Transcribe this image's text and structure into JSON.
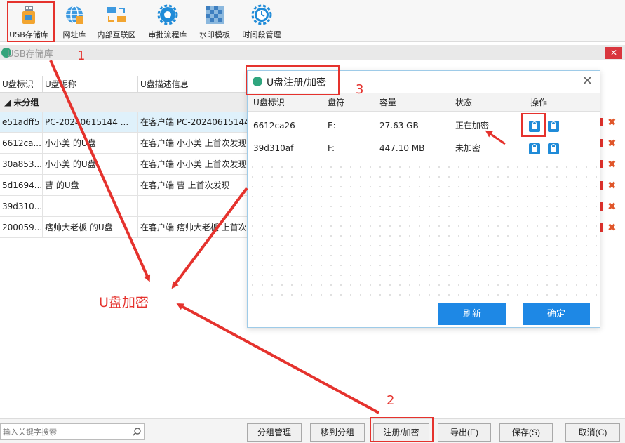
{
  "toolbar": {
    "items": [
      {
        "label": "USB存储库",
        "icon": "usb-storage-icon"
      },
      {
        "label": "网址库",
        "icon": "globe-icon"
      },
      {
        "label": "内部互联区",
        "icon": "network-icon"
      },
      {
        "label": "审批流程库",
        "icon": "approval-gear-icon"
      },
      {
        "label": "水印模板",
        "icon": "watermark-icon"
      },
      {
        "label": "时间段管理",
        "icon": "clock-gear-icon"
      }
    ]
  },
  "window": {
    "title": "USB存储库",
    "close": "✕"
  },
  "table": {
    "columns": [
      "U盘标识",
      "U盘昵称",
      "U盘描述信息"
    ],
    "group": "未分组",
    "rows": [
      {
        "id": "e51adff5",
        "nick": "PC-20240615144 ...",
        "desc": "在客户端 PC-20240615144"
      },
      {
        "id": "6612ca...",
        "nick": "小小美 的U盘",
        "desc": "在客户端 小小美 上首次发现"
      },
      {
        "id": "30a853...",
        "nick": "小小美 的U盘",
        "desc": "在客户端 小小美 上首次发现"
      },
      {
        "id": "5d1694...",
        "nick": "曹 的U盘",
        "desc": "在客户端 曹 上首次发现"
      },
      {
        "id": "39d310...",
        "nick": "",
        "desc": ""
      },
      {
        "id": "200059...",
        "nick": "痞帅大老板 的U盘",
        "desc": "在客户端 痞帅大老板 上首次发"
      }
    ],
    "delete_glyph": "✖"
  },
  "dialog": {
    "title": "U盘注册/加密",
    "close": "✕",
    "columns": [
      "U盘标识",
      "盘符",
      "容量",
      "状态",
      "操作"
    ],
    "rows": [
      {
        "id": "6612ca26",
        "drive": "E:",
        "capacity": "27.63 GB",
        "status": "正在加密"
      },
      {
        "id": "39d310af",
        "drive": "F:",
        "capacity": "447.10 MB",
        "status": "未加密"
      }
    ],
    "refresh": "刷新",
    "ok": "确定"
  },
  "bottom": {
    "search_placeholder": "输入关键字搜索",
    "buttons": [
      "分组管理",
      "移到分组",
      "注册/加密",
      "导出(E)",
      "保存(S)",
      "取消(C)"
    ]
  },
  "annotations": {
    "n1": "1",
    "n2": "2",
    "n3": "3",
    "label": "U盘加密",
    "color": "#e5322d"
  },
  "colors": {
    "accent": "#1e88e5",
    "lock_blue": "#1f8bd8",
    "delete": "#e0562a"
  }
}
